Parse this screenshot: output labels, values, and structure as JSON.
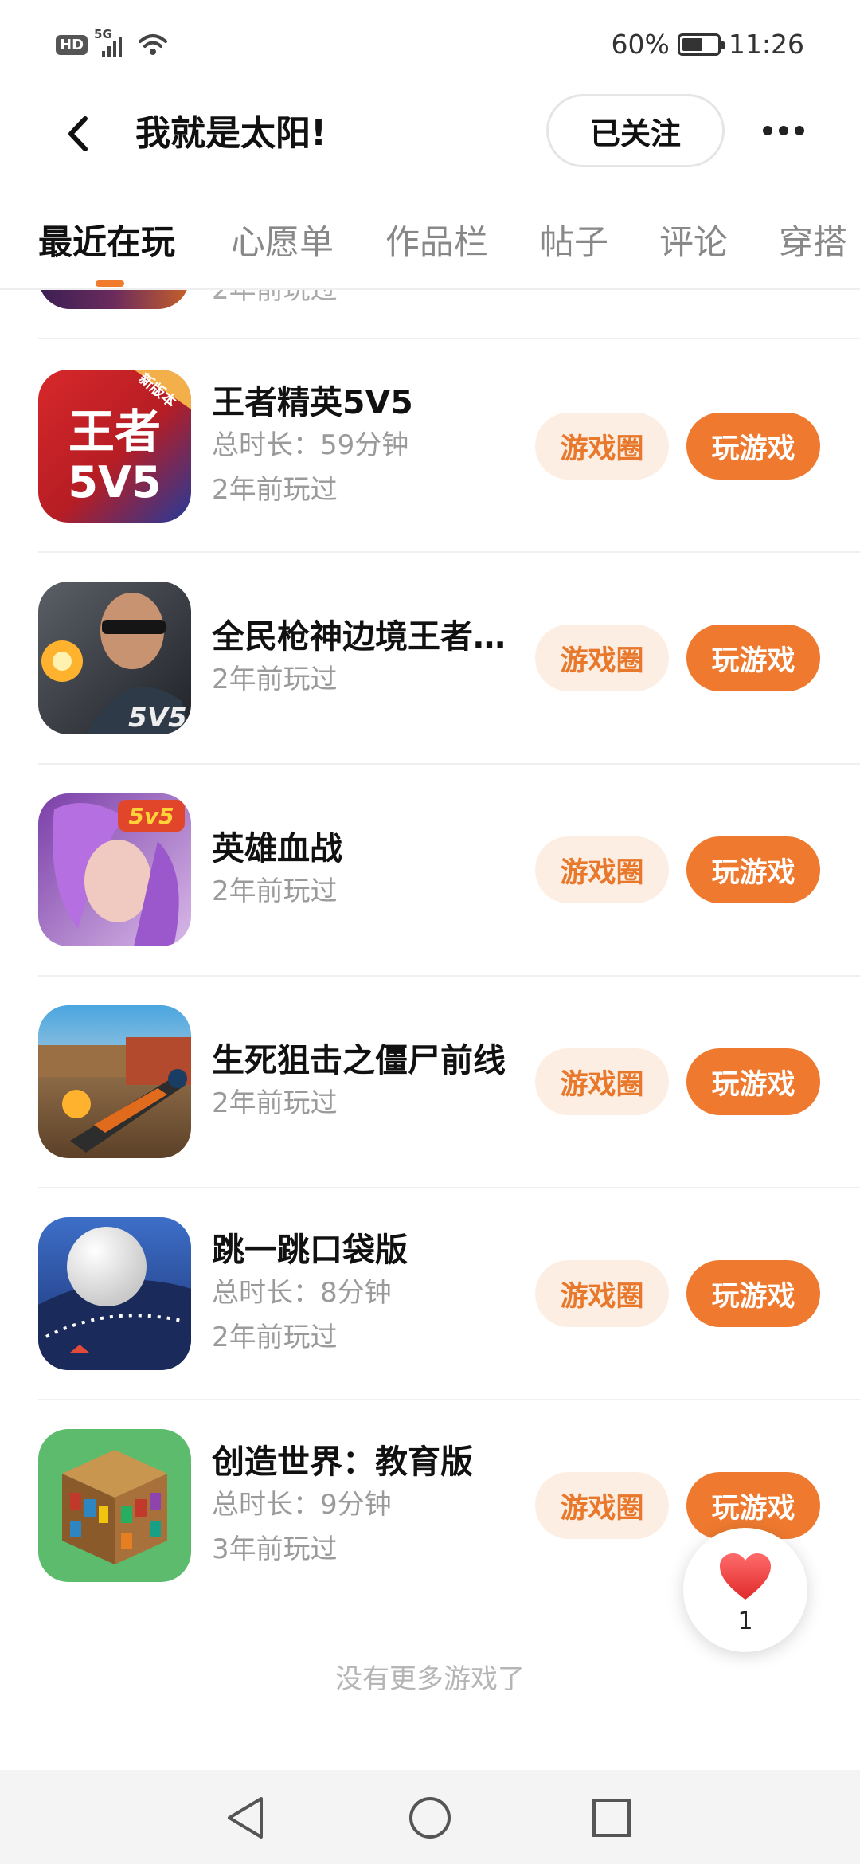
{
  "status_bar": {
    "hd": "HD",
    "network": "5G",
    "battery": "60%",
    "battery_level": 0.6,
    "time": "11:26"
  },
  "header": {
    "title": "我就是太阳!",
    "follow_label": "已关注"
  },
  "tabs": [
    {
      "label": "最近在玩",
      "active": true
    },
    {
      "label": "心愿单",
      "active": false
    },
    {
      "label": "作品栏",
      "active": false
    },
    {
      "label": "帖子",
      "active": false
    },
    {
      "label": "评论",
      "active": false
    },
    {
      "label": "穿搭",
      "active": false
    }
  ],
  "partial_item": {
    "last_played": "2年前玩过"
  },
  "games": [
    {
      "name": "王者精英5V5",
      "total_time": "总时长：59分钟",
      "last_played": "2年前玩过",
      "icon": "wangzhe-5v5-icon",
      "icon_text_1": "王者",
      "icon_text_2": "5V5",
      "icon_badge": "新版本"
    },
    {
      "name": "全民枪神边境王者…",
      "total_time": null,
      "last_played": "2年前玩过",
      "icon": "quanmin-qiangshen-icon",
      "icon_text_1": "5V5"
    },
    {
      "name": "英雄血战",
      "total_time": null,
      "last_played": "2年前玩过",
      "icon": "yingxiong-xuezhan-icon",
      "icon_text_1": "5v5"
    },
    {
      "name": "生死狙击之僵尸前线",
      "total_time": null,
      "last_played": "2年前玩过",
      "icon": "shengsi-juji-icon"
    },
    {
      "name": "跳一跳口袋版",
      "total_time": "总时长：8分钟",
      "last_played": "2年前玩过",
      "icon": "tiaoyitiao-icon"
    },
    {
      "name": "创造世界：教育版",
      "total_time": "总时长：9分钟",
      "last_played": "3年前玩过",
      "icon": "chuangzao-shijie-icon"
    }
  ],
  "actions": {
    "circle_label": "游戏圈",
    "play_label": "玩游戏"
  },
  "footer_note": "没有更多游戏了",
  "like": {
    "count": "1"
  },
  "colors": {
    "accent": "#ef7a2f",
    "accent_light": "#fdeee3",
    "muted": "#9a9a9a"
  }
}
